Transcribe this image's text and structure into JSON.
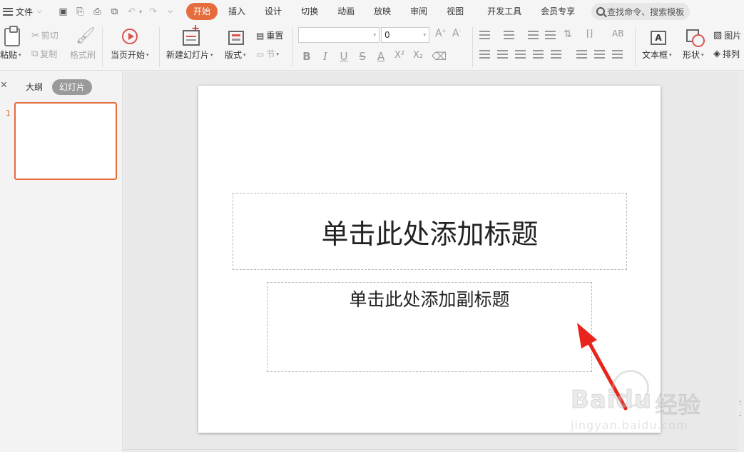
{
  "menubar": {
    "file_label": "文件",
    "tabs": [
      "开始",
      "插入",
      "设计",
      "切换",
      "动画",
      "放映",
      "审阅",
      "视图",
      "开发工具",
      "会员专享"
    ],
    "active_tab": "开始",
    "search_placeholder": "查找命令、搜索模板"
  },
  "ribbon": {
    "clipboard": {
      "paste": "粘贴",
      "cut": "剪切",
      "copy": "复制",
      "format_painter": "格式刷"
    },
    "slideshow": {
      "from_current": "当页开始"
    },
    "slides": {
      "new_slide": "新建幻灯片",
      "layout": "版式",
      "reset": "重置",
      "section": "节"
    },
    "font": {
      "font_name": "",
      "font_size": "0"
    },
    "insert": {
      "textbox": "文本框",
      "shape": "形状",
      "picture": "图片",
      "arrange": "排列"
    }
  },
  "left_panel": {
    "tab_outline": "大纲",
    "tab_slides": "幻灯片",
    "active_tab": "幻灯片",
    "slide_number": "1"
  },
  "slide": {
    "title_placeholder": "单击此处添加标题",
    "subtitle_placeholder": "单击此处添加副标题"
  },
  "watermark": {
    "brand": "Baidu",
    "brand_cn": "经验",
    "url": "jingyan.baidu.com"
  },
  "colors": {
    "accent": "#e46c3d",
    "annotation_arrow": "#e8241c",
    "workspace_bg": "#e9e9e9"
  }
}
